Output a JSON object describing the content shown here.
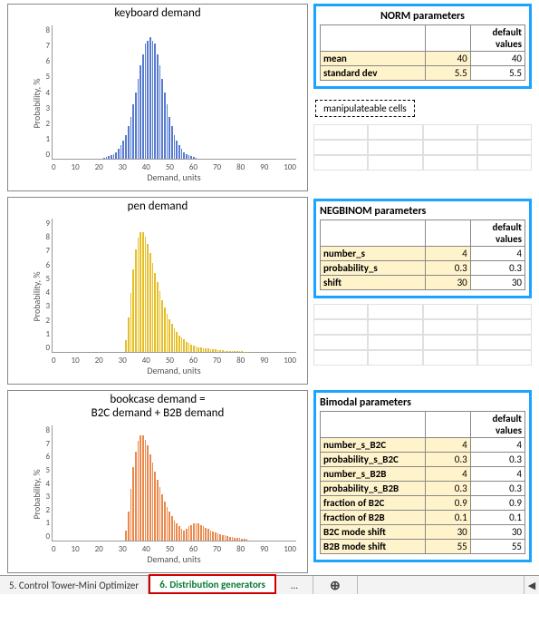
{
  "labels": {
    "ylabel": "Probability, %",
    "xlabel": "Demand, units",
    "defaults_header": "default values",
    "manip": "manipulateable cells"
  },
  "xticks": [
    "0",
    "10",
    "20",
    "30",
    "40",
    "50",
    "60",
    "70",
    "80",
    "90",
    "100"
  ],
  "charts": {
    "norm": {
      "title": "keyboard demand",
      "param_title": "NORM parameters",
      "color": "#3a64c8",
      "yticks": [
        "0",
        "1",
        "2",
        "3",
        "4",
        "5",
        "6",
        "7",
        "8"
      ],
      "params": [
        {
          "name": "mean",
          "value": "40",
          "default": "40"
        },
        {
          "name": "standard dev",
          "value": "5.5",
          "default": "5.5"
        }
      ]
    },
    "negbinom": {
      "title": "pen demand",
      "param_title": "NEGBINOM parameters",
      "color": "#e2b400",
      "yticks": [
        "0",
        "1",
        "2",
        "3",
        "4",
        "5",
        "6",
        "7",
        "8",
        "9"
      ],
      "params": [
        {
          "name": "number_s",
          "value": "4",
          "default": "4"
        },
        {
          "name": "probability_s",
          "value": "0.3",
          "default": "0.3"
        },
        {
          "name": "shift",
          "value": "30",
          "default": "30"
        }
      ]
    },
    "bimodal": {
      "title": "bookcase demand =\nB2C demand + B2B demand",
      "param_title": "Bimodal parameters",
      "color": "#e8732c",
      "yticks": [
        "0",
        "1",
        "2",
        "3",
        "4",
        "5",
        "6",
        "7",
        "8"
      ],
      "params": [
        {
          "name": "number_s_B2C",
          "value": "4",
          "default": "4"
        },
        {
          "name": "probability_s_B2C",
          "value": "0.3",
          "default": "0.3"
        },
        {
          "name": "number_s_B2B",
          "value": "4",
          "default": "4"
        },
        {
          "name": "probability_s_B2B",
          "value": "0.3",
          "default": "0.3"
        },
        {
          "name": "fraction of B2C",
          "value": "0.9",
          "default": "0.9"
        },
        {
          "name": "fraction of B2B",
          "value": "0.1",
          "default": "0.1"
        },
        {
          "name": "B2C mode shift",
          "value": "30",
          "default": "30"
        },
        {
          "name": "B2B mode shift",
          "value": "55",
          "default": "55"
        }
      ]
    }
  },
  "tabs": {
    "prev": "5. Control Tower-Mini Optimizer",
    "active": "6. Distribution generators",
    "overflow": "…",
    "add": "⊕",
    "scroll_left": "◀"
  },
  "chart_data": [
    {
      "type": "bar",
      "title": "keyboard demand",
      "xlabel": "Demand, units",
      "ylabel": "Probability, %",
      "xlim": [
        0,
        100
      ],
      "ylim": [
        0,
        8
      ],
      "distribution": {
        "family": "normal",
        "mean": 40,
        "sd": 5.5
      },
      "x": [
        20,
        22,
        24,
        26,
        28,
        30,
        32,
        34,
        36,
        38,
        40,
        42,
        44,
        46,
        48,
        50,
        52,
        54,
        56,
        58,
        60
      ],
      "values": [
        0.0,
        0.1,
        0.2,
        0.4,
        0.8,
        1.4,
        2.5,
        4.0,
        5.6,
        6.9,
        7.3,
        6.9,
        5.6,
        4.0,
        2.5,
        1.4,
        0.8,
        0.4,
        0.2,
        0.1,
        0.0
      ]
    },
    {
      "type": "bar",
      "title": "pen demand",
      "xlabel": "Demand, units",
      "ylabel": "Probability, %",
      "xlim": [
        0,
        100
      ],
      "ylim": [
        0,
        9
      ],
      "distribution": {
        "family": "negative_binomial",
        "number_s": 4,
        "probability_s": 0.3,
        "shift": 30
      },
      "x": [
        30,
        31,
        32,
        33,
        34,
        35,
        36,
        37,
        38,
        39,
        40,
        41,
        42,
        43,
        44,
        45,
        46,
        48,
        50,
        52,
        55,
        58,
        60,
        65,
        70,
        75,
        80
      ],
      "values": [
        0.8,
        2.3,
        4.0,
        5.6,
        6.9,
        7.7,
        8.1,
        8.1,
        7.8,
        7.3,
        6.7,
        6.0,
        5.3,
        4.7,
        4.1,
        3.5,
        3.0,
        2.2,
        1.6,
        1.1,
        0.7,
        0.4,
        0.3,
        0.2,
        0.1,
        0.05,
        0.02
      ]
    },
    {
      "type": "bar",
      "title": "bookcase demand = B2C demand + B2B demand",
      "xlabel": "Demand, units",
      "ylabel": "Probability, %",
      "xlim": [
        0,
        100
      ],
      "ylim": [
        0,
        8
      ],
      "distribution": {
        "family": "bimodal_negative_binomial",
        "components": [
          {
            "label": "B2C",
            "number_s": 4,
            "probability_s": 0.3,
            "shift": 30,
            "fraction": 0.9
          },
          {
            "label": "B2B",
            "number_s": 4,
            "probability_s": 0.3,
            "shift": 55,
            "fraction": 0.1
          }
        ]
      },
      "x": [
        30,
        31,
        32,
        33,
        34,
        35,
        36,
        37,
        38,
        39,
        40,
        41,
        42,
        43,
        44,
        45,
        46,
        48,
        50,
        52,
        54,
        55,
        56,
        57,
        58,
        59,
        60,
        61,
        62,
        63,
        65,
        68,
        70,
        75,
        80
      ],
      "values": [
        0.7,
        2.0,
        3.6,
        5.1,
        6.2,
        6.9,
        7.3,
        7.3,
        7.0,
        6.6,
        6.0,
        5.4,
        4.8,
        4.2,
        3.7,
        3.2,
        2.7,
        2.0,
        1.4,
        1.0,
        0.7,
        0.8,
        1.0,
        1.1,
        1.2,
        1.2,
        1.2,
        1.1,
        1.0,
        0.9,
        0.7,
        0.5,
        0.4,
        0.2,
        0.1
      ]
    }
  ]
}
